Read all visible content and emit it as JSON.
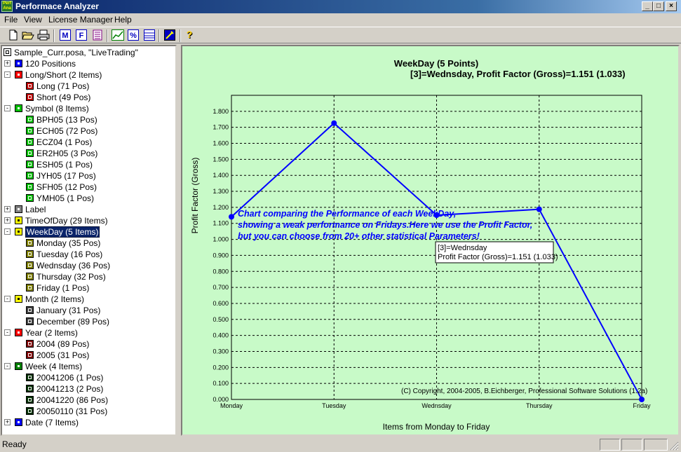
{
  "window": {
    "title": "Performace Analyzer",
    "icon_text_top": "Perf",
    "icon_text_bottom": "Ana"
  },
  "menu": [
    "File",
    "View",
    "License Manager",
    "Help"
  ],
  "toolbar": {
    "icons": [
      "new-file-icon",
      "open-folder-icon",
      "print-icon",
      "m-icon",
      "f-icon",
      "list-report-icon",
      "chart-icon",
      "percent-icon",
      "table-icon",
      "settings-icon",
      "help-icon"
    ]
  },
  "tree": {
    "root": "Sample_Curr.posa, \"LiveTrading\"",
    "nodes": [
      {
        "label": "120 Positions",
        "level": 1,
        "color": "#0000ff",
        "expander": "+"
      },
      {
        "label": "Long/Short (2 Items)",
        "level": 1,
        "color": "#ff0000",
        "expander": "-"
      },
      {
        "label": "Long (71 Pos)",
        "level": 2,
        "color": "#c00000"
      },
      {
        "label": "Short (49 Pos)",
        "level": 2,
        "color": "#c00000"
      },
      {
        "label": "Symbol (8 Items)",
        "level": 1,
        "color": "#00c000",
        "expander": "-"
      },
      {
        "label": "BPH05 (13 Pos)",
        "level": 2,
        "color": "#00c000"
      },
      {
        "label": "ECH05 (72 Pos)",
        "level": 2,
        "color": "#00c000"
      },
      {
        "label": "ECZ04 (1 Pos)",
        "level": 2,
        "color": "#00c000"
      },
      {
        "label": "ER2H05 (3 Pos)",
        "level": 2,
        "color": "#00c000"
      },
      {
        "label": "ESH05 (1 Pos)",
        "level": 2,
        "color": "#00c000"
      },
      {
        "label": "JYH05 (17 Pos)",
        "level": 2,
        "color": "#00c000"
      },
      {
        "label": "SFH05 (12 Pos)",
        "level": 2,
        "color": "#00c000"
      },
      {
        "label": "YMH05 (1 Pos)",
        "level": 2,
        "color": "#00c000"
      },
      {
        "label": "Label",
        "level": 1,
        "color": "#808080",
        "expander": "+"
      },
      {
        "label": "TimeOfDay (29 Items)",
        "level": 1,
        "color": "#ffff00",
        "expander": "+"
      },
      {
        "label": "WeekDay (5 Items)",
        "level": 1,
        "color": "#ffff00",
        "expander": "-",
        "selected": true
      },
      {
        "label": "Monday (35 Pos)",
        "level": 2,
        "color": "#808000"
      },
      {
        "label": "Tuesday (16 Pos)",
        "level": 2,
        "color": "#808000"
      },
      {
        "label": "Wednsday (36 Pos)",
        "level": 2,
        "color": "#808000"
      },
      {
        "label": "Thursday (32 Pos)",
        "level": 2,
        "color": "#808000"
      },
      {
        "label": "Friday (1 Pos)",
        "level": 2,
        "color": "#808000"
      },
      {
        "label": "Month (2 Items)",
        "level": 1,
        "color": "#ffff00",
        "expander": "-"
      },
      {
        "label": "January (31 Pos)",
        "level": 2,
        "color": "#404040"
      },
      {
        "label": "December (89 Pos)",
        "level": 2,
        "color": "#404040"
      },
      {
        "label": "Year (2 Items)",
        "level": 1,
        "color": "#ff0000",
        "expander": "-"
      },
      {
        "label": "2004 (89 Pos)",
        "level": 2,
        "color": "#800000"
      },
      {
        "label": "2005 (31 Pos)",
        "level": 2,
        "color": "#800000"
      },
      {
        "label": "Week (4 Items)",
        "level": 1,
        "color": "#008000",
        "expander": "-"
      },
      {
        "label": "20041206 (1 Pos)",
        "level": 2,
        "color": "#003000"
      },
      {
        "label": "20041213 (2 Pos)",
        "level": 2,
        "color": "#003000"
      },
      {
        "label": "20041220 (86 Pos)",
        "level": 2,
        "color": "#003000"
      },
      {
        "label": "20050110 (31 Pos)",
        "level": 2,
        "color": "#003000"
      },
      {
        "label": "Date (7 Items)",
        "level": 1,
        "color": "#0000ff",
        "expander": "+"
      }
    ]
  },
  "chart_data": {
    "type": "line",
    "title": "WeekDay (5 Points)",
    "subtitle": "[3]=Wednsday,   Profit Factor (Gross)=1.151 (1.033)",
    "xlabel": "Items from Monday to Friday",
    "ylabel": "Profit Factor (Gross)",
    "categories": [
      "Monday",
      "Tuesday",
      "Wednsday",
      "Thursday",
      "Friday"
    ],
    "values": [
      1.141,
      1.726,
      1.151,
      1.188,
      0.0
    ],
    "ylim": [
      0,
      1.9
    ],
    "yticks": [
      "0.000",
      "0.100",
      "0.200",
      "0.300",
      "0.400",
      "0.500",
      "0.600",
      "0.700",
      "0.800",
      "0.900",
      "1.000",
      "1.100",
      "1.200",
      "1.300",
      "1.400",
      "1.500",
      "1.600",
      "1.700",
      "1.800"
    ],
    "grid": true,
    "line_color": "#0000ff",
    "background": "#c8fac8",
    "annotation_lines": [
      "Chart comparing the Performance of each WeekDay,",
      "showing a weak performance on Fridays.Here we use the Profit Factor,",
      "but you can choose from 20+ other statistical Parameters!"
    ],
    "tooltip_lines": [
      "[3]=Wednsday",
      "Profit Factor (Gross)=1.151 (1.033)"
    ],
    "copyright": "(C) Copyright, 2004-2005, B.Eichberger, Professional Software Solutions (1.2a)"
  },
  "status": {
    "text": "Ready"
  }
}
